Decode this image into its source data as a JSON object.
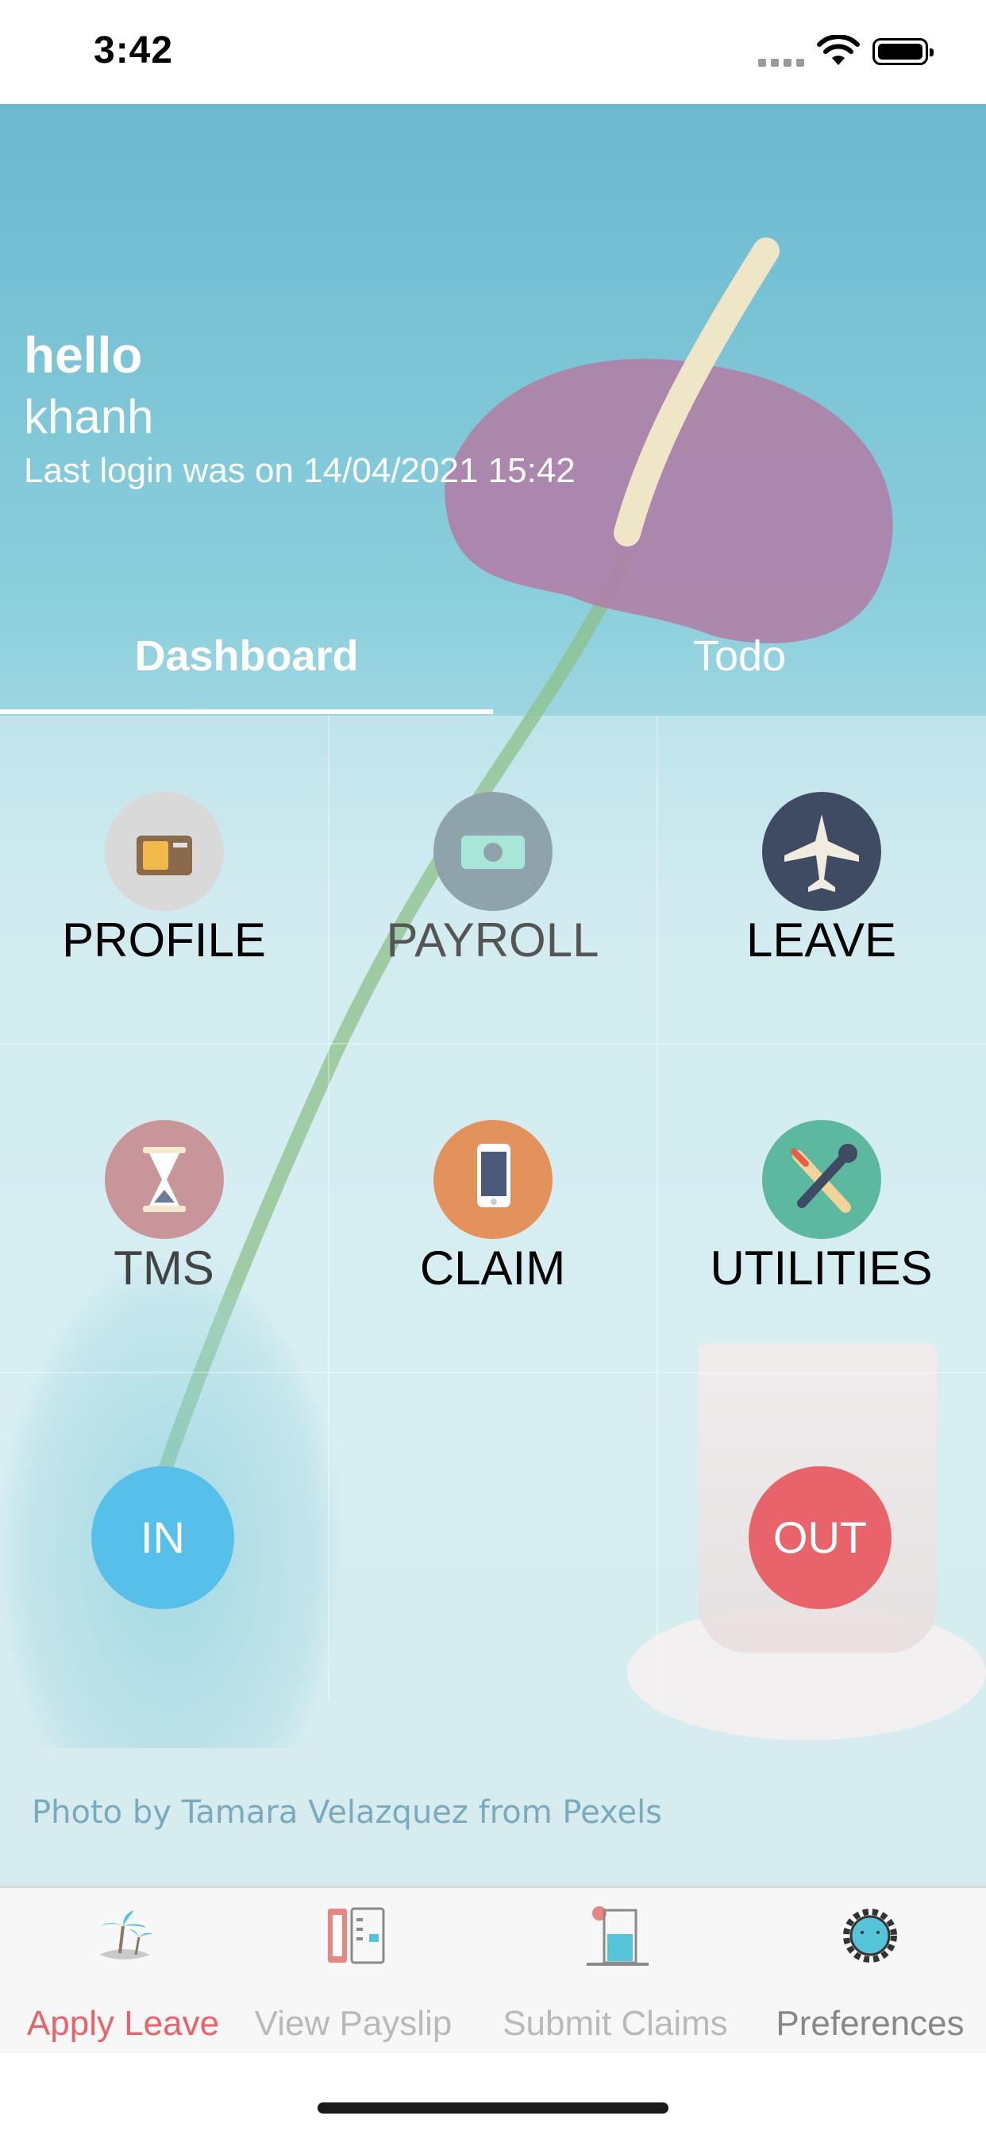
{
  "status_bar": {
    "time": "3:42"
  },
  "header": {
    "greeting": "hello",
    "username": "khanh",
    "last_login": "Last login was on 14/04/2021 15:42"
  },
  "tabs": [
    {
      "label": "Dashboard",
      "selected": true
    },
    {
      "label": "Todo",
      "selected": false
    }
  ],
  "tiles": [
    {
      "label": "PROFILE",
      "icon": "id-card-icon",
      "color": "#d9d9d9",
      "label_color": "#000000"
    },
    {
      "label": "PAYROLL",
      "icon": "money-icon",
      "color": "#8fa3ad",
      "label_color": "#555555"
    },
    {
      "label": "LEAVE",
      "icon": "airplane-icon",
      "color": "#3f4b63",
      "label_color": "#000000"
    },
    {
      "label": "TMS",
      "icon": "hourglass-icon",
      "color": "#c8969a",
      "label_color": "#444444"
    },
    {
      "label": "CLAIM",
      "icon": "phone-icon",
      "color": "#e2925a",
      "label_color": "#000000"
    },
    {
      "label": "UTILITIES",
      "icon": "tools-icon",
      "color": "#5db8a0",
      "label_color": "#000000"
    }
  ],
  "clock": {
    "in_label": "IN",
    "out_label": "OUT"
  },
  "photo_credit": "Photo by Tamara Velazquez from Pexels",
  "tab_bar": [
    {
      "label": "Apply Leave",
      "icon": "island-icon",
      "color": "#e8636a"
    },
    {
      "label": "View Payslip",
      "icon": "payslip-icon",
      "color": "#b9b9b9"
    },
    {
      "label": "Submit Claims",
      "icon": "claims-icon",
      "color": "#b9b9b9"
    },
    {
      "label": "Preferences",
      "icon": "gear-icon",
      "color": "#888888"
    }
  ]
}
